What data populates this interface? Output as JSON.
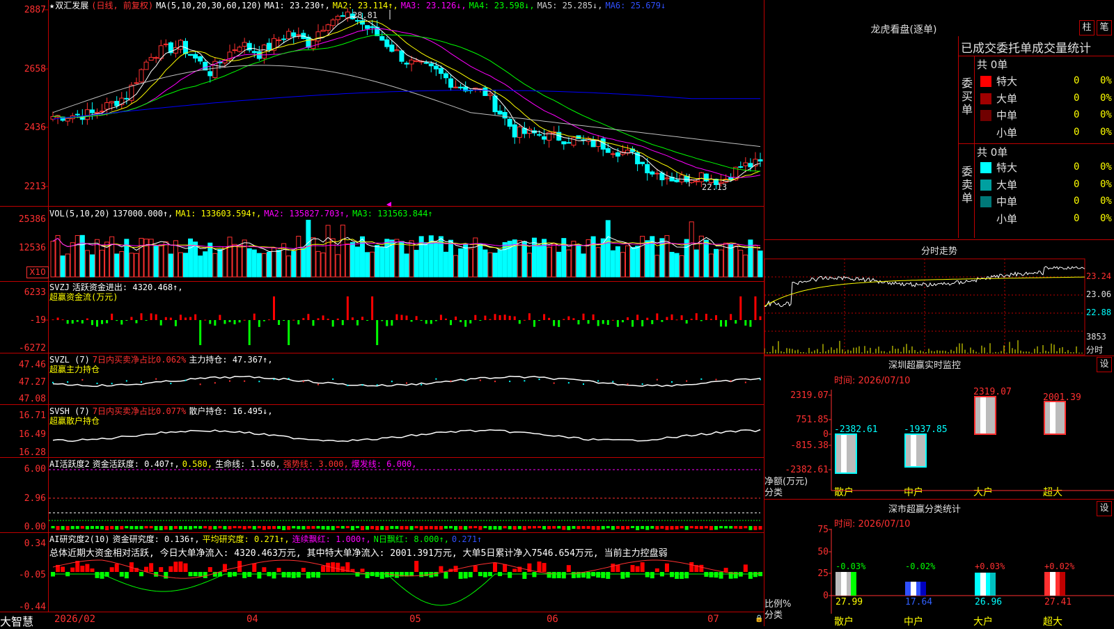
{
  "colors": {
    "up": "#ff3030",
    "down": "#00ffff",
    "ma1": "#ffffff",
    "ma2": "#ffff00",
    "ma3": "#ff00ff",
    "ma4": "#00ff00",
    "ma5": "#c0c0c0",
    "ma6": "#0000ff",
    "grid": "#c00000",
    "axis_text": "#ff3030"
  },
  "main_chart": {
    "header": {
      "star": "★",
      "stock_name": "双汇发展",
      "period": "(日线, 前复权)",
      "ma_label": "MA(5,10,20,30,60,120)",
      "ma1": "MA1: 23.230↑,",
      "ma2": "MA2: 23.114↑,",
      "ma3": "MA3: 23.126↓,",
      "ma4": "MA4: 23.598↓,",
      "ma5": "MA5: 25.285↓,",
      "ma6": "MA6: 25.679↓"
    },
    "y_ticks": [
      "2887",
      "2658",
      "2436",
      "2213"
    ],
    "high_label": "28.81",
    "low_label": "22.13"
  },
  "vol_panel": {
    "header": {
      "name": "VOL(5,10,20)",
      "value": "137000.000↑,",
      "ma1": "MA1: 133603.594↑,",
      "ma2": "MA2: 135827.703↑,",
      "ma3": "MA3: 131563.844↑"
    },
    "y_ticks": [
      "25386",
      "12536"
    ],
    "unit": "X10"
  },
  "svzj_panel": {
    "header": {
      "name": "SVZJ",
      "label": "活跃资金进出: 4320.468↑,",
      "sub": "超赢资金流(万元)"
    },
    "y_ticks": [
      "6233",
      "-19",
      "-6272"
    ]
  },
  "svzl_panel": {
    "header": {
      "name": "SVZL (7)",
      "ratio": "7日内买卖净占比0.062%",
      "hold": "主力持仓: 47.367↑,",
      "sub": "超赢主力持仓"
    },
    "y_ticks": [
      "47.46",
      "47.27",
      "47.08"
    ]
  },
  "svsh_panel": {
    "header": {
      "name": "SVSH (7)",
      "ratio": "7日内买卖净占比0.077%",
      "hold": "散户持仓: 16.495↓,",
      "sub": "超赢散户持仓"
    },
    "y_ticks": [
      "16.71",
      "16.49",
      "16.28"
    ]
  },
  "ai_act_panel": {
    "header": {
      "name": "AI活跃度2",
      "act": "资金活跃度: 0.407↑,",
      "v2": "0.580,",
      "life": "生命线: 1.560,",
      "strong": "强势线: 3.000,",
      "burst": "爆发线: 6.000,"
    },
    "y_ticks": [
      "6.00",
      "2.96",
      "0.00"
    ]
  },
  "ai_res_panel": {
    "header": {
      "name": "AI研究度2(10)",
      "res": "资金研究度: 0.136↑,",
      "avg": "平均研究度: 0.271↑,",
      "cont": "连续飘红: 1.000↑,",
      "nday": "N日飘红: 8.000↑,",
      "last": "0.271↑"
    },
    "summary": "总体近期大资金相对活跃, 今日大单净流入: 4320.463万元, 其中特大单净流入: 2001.391万元, 大单5日累计净入7546.654万元, 当前主力控盘弱",
    "y_ticks": [
      "0.34",
      "-0.05",
      "-0.44"
    ]
  },
  "bottom": {
    "brand": "大智慧",
    "dates": [
      "2026/02",
      "04",
      "05",
      "06",
      "07"
    ]
  },
  "right": {
    "lhb": {
      "title": "龙虎看盘(逐单)",
      "btn1": "柱",
      "btn2": "笔",
      "subtitle": "已成交委托单成交量统计",
      "buy": {
        "side": "委买单",
        "total": "共 0单",
        "rows": [
          {
            "label": "特大",
            "count": "0",
            "pct": "0%",
            "color": "#ff0000"
          },
          {
            "label": "大单",
            "count": "0",
            "pct": "0%",
            "color": "#a00000"
          },
          {
            "label": "中单",
            "count": "0",
            "pct": "0%",
            "color": "#700000"
          },
          {
            "label": "小单",
            "count": "0",
            "pct": "0%",
            "color": ""
          }
        ]
      },
      "sell": {
        "side": "委卖单",
        "total": "共 0单",
        "rows": [
          {
            "label": "特大",
            "count": "0",
            "pct": "0%",
            "color": "#00ffff"
          },
          {
            "label": "大单",
            "count": "0",
            "pct": "0%",
            "color": "#00a0a0"
          },
          {
            "label": "中单",
            "count": "0",
            "pct": "0%",
            "color": "#007878"
          },
          {
            "label": "小单",
            "count": "0",
            "pct": "0%",
            "color": ""
          }
        ]
      }
    },
    "fenshi": {
      "title": "分时走势",
      "y_ticks": [
        "23.24",
        "23.06",
        "22.88"
      ],
      "vol": "3853",
      "vol_unit": "分时"
    },
    "monitor": {
      "title": "深圳超赢实时监控",
      "btn": "设",
      "time": "时间: 2026/07/10",
      "y_ticks": [
        "2319.07",
        "751.85",
        "0",
        "-815.38",
        "-2382.61"
      ],
      "axis_label1": "净额(万元)",
      "axis_label2": "分类",
      "categories": [
        "散户",
        "中户",
        "大户",
        "超大"
      ],
      "values": [
        "-2382.61",
        "-1937.85",
        "2319.07",
        "2001.39"
      ]
    },
    "classify": {
      "title": "深市超赢分类统计",
      "btn": "设",
      "time": "时间: 2026/07/10",
      "y_ticks": [
        "75",
        "50",
        "25",
        "0"
      ],
      "axis_label1": "比例%",
      "axis_label2": "分类",
      "categories": [
        "散户",
        "中户",
        "大户",
        "超大"
      ],
      "changes": [
        "-0.03%",
        "-0.02%",
        "+0.03%",
        "+0.02%"
      ],
      "values": [
        "27.99",
        "17.64",
        "26.96",
        "27.41"
      ]
    }
  }
}
